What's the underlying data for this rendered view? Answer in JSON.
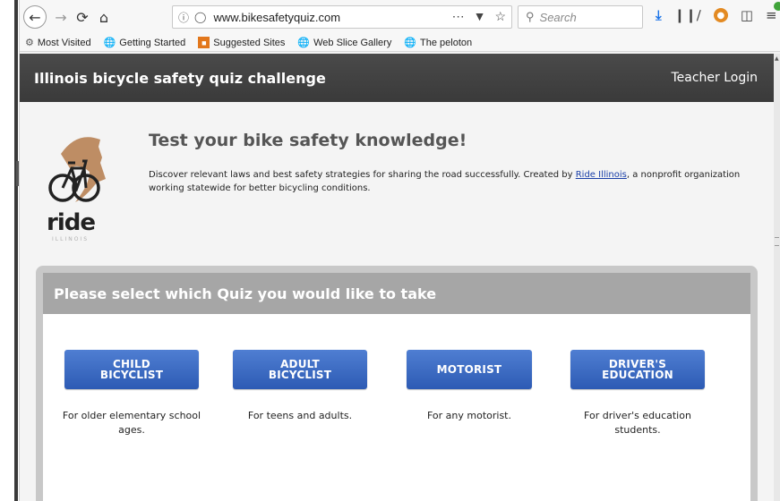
{
  "browser": {
    "url": "www.bikesafetyquiz.com",
    "search_placeholder": "Search",
    "bookmarks": [
      {
        "label": "Most Visited",
        "icon": "gear-icon"
      },
      {
        "label": "Getting Started",
        "icon": "globe-icon"
      },
      {
        "label": "Suggested Sites",
        "icon": "bookmark-icon"
      },
      {
        "label": "Web Slice Gallery",
        "icon": "globe-icon"
      },
      {
        "label": "The peloton",
        "icon": "globe-icon"
      }
    ]
  },
  "site": {
    "title": "Illinois bicycle safety quiz challenge",
    "teacher_login": "Teacher Login"
  },
  "intro": {
    "heading": "Test your bike safety knowledge!",
    "text_before_link": "Discover relevant laws and best safety strategies for sharing the road successfully. Created by ",
    "link_text": "Ride Illinois",
    "text_after_link": ", a nonprofit organization working statewide for better bicycling conditions.",
    "logo_word": "ride",
    "logo_sub": "ILLINOIS"
  },
  "quiz": {
    "heading": "Please select which Quiz you would like to take",
    "options": [
      {
        "button": "CHILD\nBICYCLIST",
        "description": "For older elementary school ages."
      },
      {
        "button": "ADULT\nBICYCLIST",
        "description": "For teens and adults."
      },
      {
        "button": "MOTORIST",
        "description": "For any motorist."
      },
      {
        "button": "DRIVER'S\nEDUCATION",
        "description": "For driver's education students."
      }
    ]
  },
  "colors": {
    "header_bg": "#3f3f3f",
    "button_blue": "#3b68c2",
    "link_blue": "#1a3fa8",
    "logo_copper": "#b47a4a"
  }
}
